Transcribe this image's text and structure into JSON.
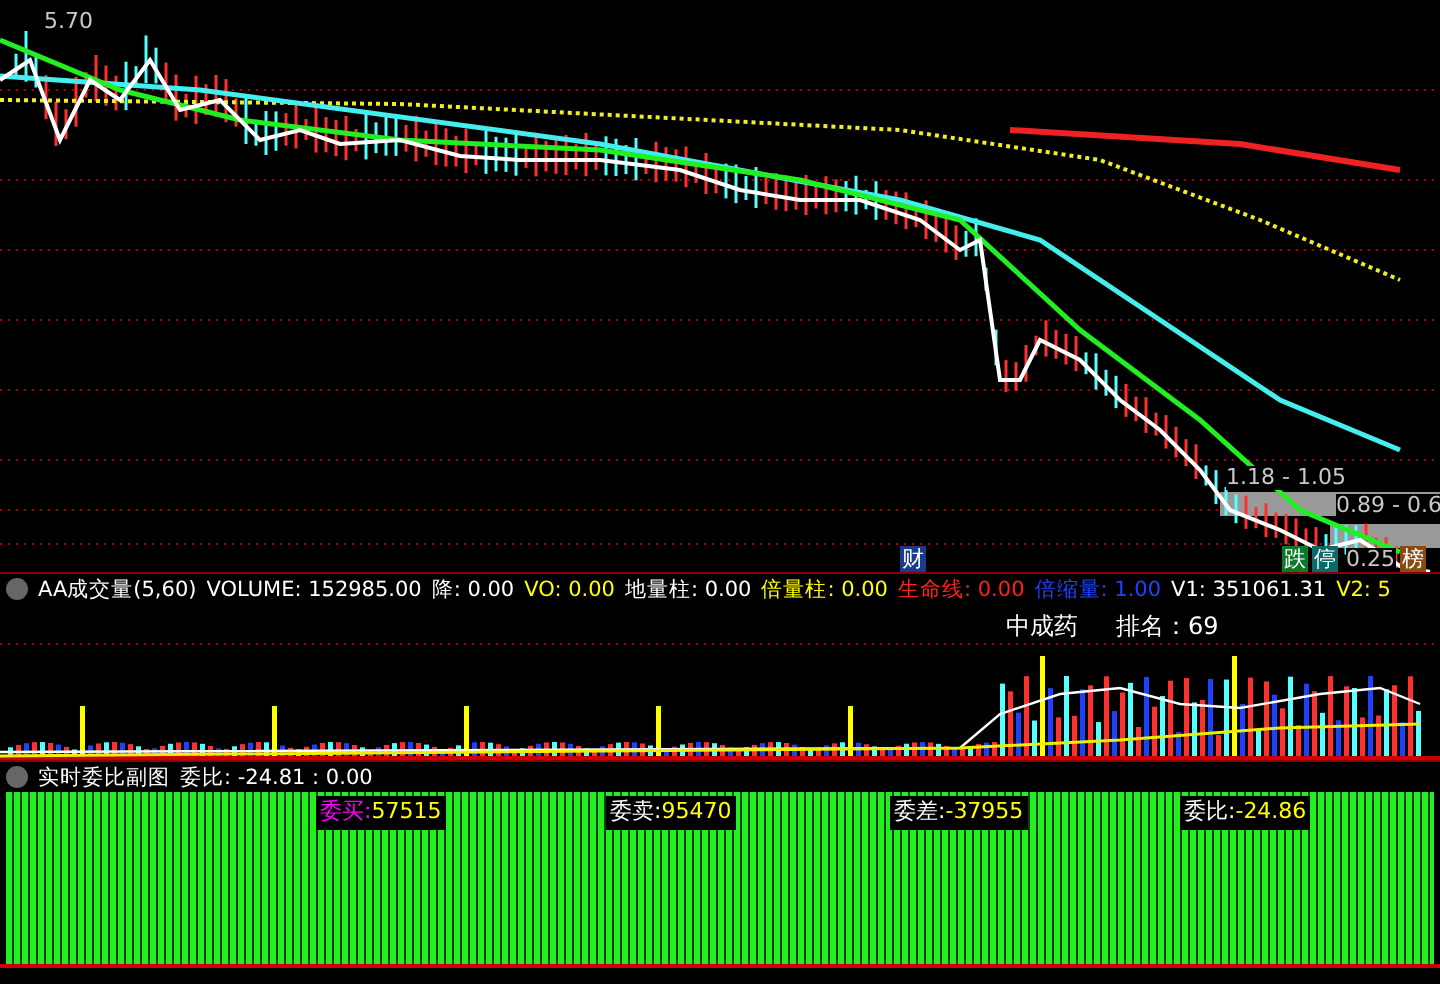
{
  "price_panel": {
    "high_label": "5.70",
    "range_labels": [
      "1.18 - 1.05",
      "0.89 - 0.6"
    ],
    "low_label": "0.25",
    "markers": [
      {
        "text": "财",
        "color": "#1a3a8a"
      },
      {
        "text": "跌",
        "color": "#0a7a2a"
      },
      {
        "text": "停",
        "color": "#0a6a6a"
      },
      {
        "text": "榜",
        "color": "#8a4a10"
      }
    ]
  },
  "volume_panel": {
    "title": "AA成交量(5,60)",
    "indicators": [
      {
        "text": "VOLUME: 152985.00",
        "color": "#ffffff"
      },
      {
        "text": "降: 0.00",
        "color": "#ffffff"
      },
      {
        "text": "VO: 0.00",
        "color": "#ffff00"
      },
      {
        "text": "地量柱: 0.00",
        "color": "#ffffff"
      },
      {
        "text": "倍量柱: 0.00",
        "color": "#ffff00"
      },
      {
        "text": "生命线: 0.00",
        "color": "#ff2020"
      },
      {
        "text": "倍缩量: 1.00",
        "color": "#2040ff"
      },
      {
        "text": "V1: 351061.31",
        "color": "#ffffff"
      },
      {
        "text": "V2: 5",
        "color": "#ffff00"
      }
    ],
    "sector": "中成药",
    "rank": "排名：69"
  },
  "ratio_panel": {
    "title": "实时委比副图",
    "ratio": "委比: -24.81 : 0.00",
    "stats": [
      {
        "label": "委买:",
        "value": "57515",
        "color": "#ff00ff"
      },
      {
        "label": "委卖:",
        "value": "95470",
        "color": "#ffffff"
      },
      {
        "label": "委差:",
        "value": "-37955",
        "color": "#ffffff"
      },
      {
        "label": "委比:",
        "value": "-24.86",
        "color": "#ffffff"
      }
    ]
  }
}
